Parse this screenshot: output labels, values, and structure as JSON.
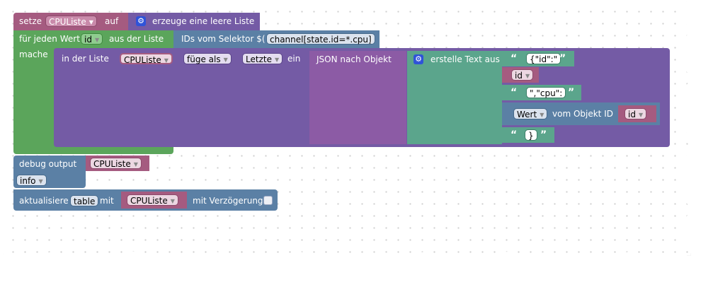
{
  "blocks": {
    "set_var": {
      "label_set": "setze",
      "var": "CPUListe",
      "label_to": "auf",
      "create_empty": "erzeuge eine leere Liste"
    },
    "for_each": {
      "label_for": "für jeden Wert",
      "var": "id",
      "label_in": "aus der Liste",
      "selector_label": "IDs vom Selektor $(",
      "selector_value": "channel[state.id=*.cpu]",
      "selector_close": ")",
      "label_do": "mache"
    },
    "list_insert": {
      "label_in_list": "in der Liste",
      "list_var": "CPUListe",
      "mode": "füge als",
      "position": "Letzte",
      "label_in": "ein"
    },
    "json_to_object": {
      "label": "JSON nach Objekt"
    },
    "text_join": {
      "label": "erstelle Text aus",
      "items": [
        {
          "type": "text",
          "value": "{\"id\":\""
        },
        {
          "type": "var",
          "value": "id"
        },
        {
          "type": "text",
          "value": "\",\"cpu\":"
        },
        {
          "type": "object_value",
          "attr": "Wert",
          "label": "vom Objekt ID",
          "var": "id"
        },
        {
          "type": "text",
          "value": "}"
        }
      ]
    },
    "debug": {
      "label": "debug output",
      "var": "CPUListe",
      "level": "info"
    },
    "update": {
      "label": "aktualisiere",
      "target": "table",
      "label_with": "mit",
      "var": "CPUListe",
      "label_delay": "mit Verzögerung"
    }
  },
  "colors": {
    "variable": "#a55b80",
    "loop": "#5ba55b",
    "list": "#745ba5",
    "json": "#8c5ba5",
    "text": "#5ba58c",
    "system": "#5b80a5"
  }
}
